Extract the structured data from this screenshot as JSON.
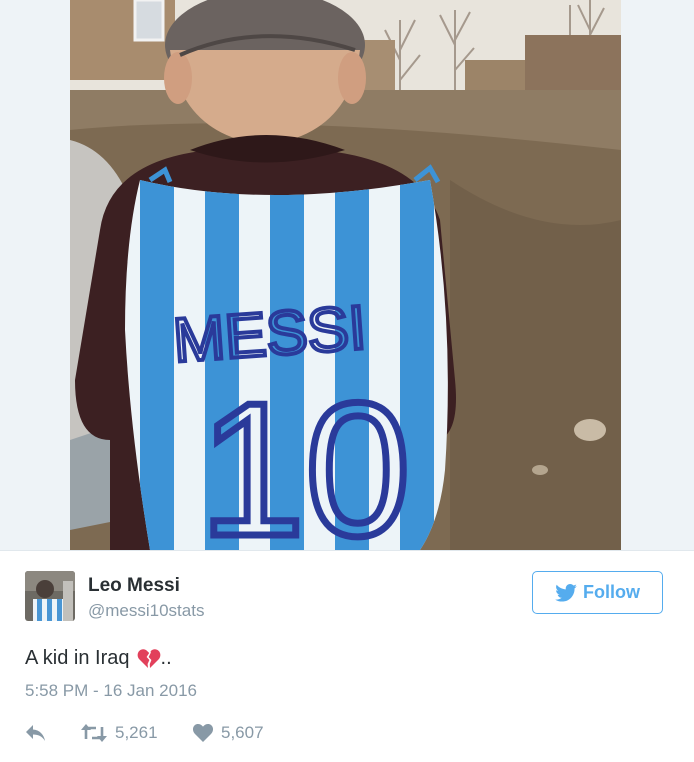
{
  "tweet": {
    "author": {
      "display_name": "Leo Messi",
      "handle": "@messi10stats"
    },
    "follow_label": "Follow",
    "text": "A kid in Iraq",
    "text_suffix": "..",
    "emoji": "broken-heart",
    "timestamp": "5:58 PM - 16 Jan 2016",
    "retweets": "5,261",
    "likes": "5,607"
  },
  "media": {
    "shirt_text": "MESSI",
    "shirt_number": "10"
  },
  "icons": {
    "bird": "twitter-bird-icon",
    "reply": "reply-icon",
    "retweet": "retweet-icon",
    "like": "heart-icon",
    "emoji": "broken-heart-emoji-icon"
  },
  "colors": {
    "accent": "#55acee",
    "name": "#292f33",
    "muted": "#8899a6",
    "emoji": "#e2405b"
  }
}
